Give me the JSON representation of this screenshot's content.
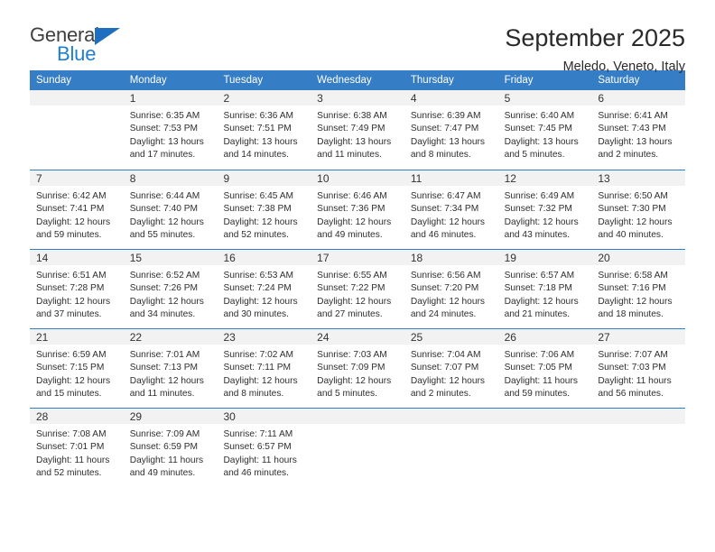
{
  "brand": {
    "name_part1": "General",
    "name_part2": "Blue",
    "triangle_color": "#1f6fc0",
    "blue_color": "#1f7fd0"
  },
  "header": {
    "title": "September 2025",
    "subtitle": "Meledo, Veneto, Italy"
  },
  "theme": {
    "header_blue": "#357dc4",
    "daynum_band": "#f2f2f2",
    "text": "#2e2e2e"
  },
  "calendar": {
    "weekday_headers": [
      "Sunday",
      "Monday",
      "Tuesday",
      "Wednesday",
      "Thursday",
      "Friday",
      "Saturday"
    ],
    "weeks": [
      [
        {
          "day": ""
        },
        {
          "day": "1",
          "sunrise": "Sunrise: 6:35 AM",
          "sunset": "Sunset: 7:53 PM",
          "daylight1": "Daylight: 13 hours",
          "daylight2": "and 17 minutes."
        },
        {
          "day": "2",
          "sunrise": "Sunrise: 6:36 AM",
          "sunset": "Sunset: 7:51 PM",
          "daylight1": "Daylight: 13 hours",
          "daylight2": "and 14 minutes."
        },
        {
          "day": "3",
          "sunrise": "Sunrise: 6:38 AM",
          "sunset": "Sunset: 7:49 PM",
          "daylight1": "Daylight: 13 hours",
          "daylight2": "and 11 minutes."
        },
        {
          "day": "4",
          "sunrise": "Sunrise: 6:39 AM",
          "sunset": "Sunset: 7:47 PM",
          "daylight1": "Daylight: 13 hours",
          "daylight2": "and 8 minutes."
        },
        {
          "day": "5",
          "sunrise": "Sunrise: 6:40 AM",
          "sunset": "Sunset: 7:45 PM",
          "daylight1": "Daylight: 13 hours",
          "daylight2": "and 5 minutes."
        },
        {
          "day": "6",
          "sunrise": "Sunrise: 6:41 AM",
          "sunset": "Sunset: 7:43 PM",
          "daylight1": "Daylight: 13 hours",
          "daylight2": "and 2 minutes."
        }
      ],
      [
        {
          "day": "7",
          "sunrise": "Sunrise: 6:42 AM",
          "sunset": "Sunset: 7:41 PM",
          "daylight1": "Daylight: 12 hours",
          "daylight2": "and 59 minutes."
        },
        {
          "day": "8",
          "sunrise": "Sunrise: 6:44 AM",
          "sunset": "Sunset: 7:40 PM",
          "daylight1": "Daylight: 12 hours",
          "daylight2": "and 55 minutes."
        },
        {
          "day": "9",
          "sunrise": "Sunrise: 6:45 AM",
          "sunset": "Sunset: 7:38 PM",
          "daylight1": "Daylight: 12 hours",
          "daylight2": "and 52 minutes."
        },
        {
          "day": "10",
          "sunrise": "Sunrise: 6:46 AM",
          "sunset": "Sunset: 7:36 PM",
          "daylight1": "Daylight: 12 hours",
          "daylight2": "and 49 minutes."
        },
        {
          "day": "11",
          "sunrise": "Sunrise: 6:47 AM",
          "sunset": "Sunset: 7:34 PM",
          "daylight1": "Daylight: 12 hours",
          "daylight2": "and 46 minutes."
        },
        {
          "day": "12",
          "sunrise": "Sunrise: 6:49 AM",
          "sunset": "Sunset: 7:32 PM",
          "daylight1": "Daylight: 12 hours",
          "daylight2": "and 43 minutes."
        },
        {
          "day": "13",
          "sunrise": "Sunrise: 6:50 AM",
          "sunset": "Sunset: 7:30 PM",
          "daylight1": "Daylight: 12 hours",
          "daylight2": "and 40 minutes."
        }
      ],
      [
        {
          "day": "14",
          "sunrise": "Sunrise: 6:51 AM",
          "sunset": "Sunset: 7:28 PM",
          "daylight1": "Daylight: 12 hours",
          "daylight2": "and 37 minutes."
        },
        {
          "day": "15",
          "sunrise": "Sunrise: 6:52 AM",
          "sunset": "Sunset: 7:26 PM",
          "daylight1": "Daylight: 12 hours",
          "daylight2": "and 34 minutes."
        },
        {
          "day": "16",
          "sunrise": "Sunrise: 6:53 AM",
          "sunset": "Sunset: 7:24 PM",
          "daylight1": "Daylight: 12 hours",
          "daylight2": "and 30 minutes."
        },
        {
          "day": "17",
          "sunrise": "Sunrise: 6:55 AM",
          "sunset": "Sunset: 7:22 PM",
          "daylight1": "Daylight: 12 hours",
          "daylight2": "and 27 minutes."
        },
        {
          "day": "18",
          "sunrise": "Sunrise: 6:56 AM",
          "sunset": "Sunset: 7:20 PM",
          "daylight1": "Daylight: 12 hours",
          "daylight2": "and 24 minutes."
        },
        {
          "day": "19",
          "sunrise": "Sunrise: 6:57 AM",
          "sunset": "Sunset: 7:18 PM",
          "daylight1": "Daylight: 12 hours",
          "daylight2": "and 21 minutes."
        },
        {
          "day": "20",
          "sunrise": "Sunrise: 6:58 AM",
          "sunset": "Sunset: 7:16 PM",
          "daylight1": "Daylight: 12 hours",
          "daylight2": "and 18 minutes."
        }
      ],
      [
        {
          "day": "21",
          "sunrise": "Sunrise: 6:59 AM",
          "sunset": "Sunset: 7:15 PM",
          "daylight1": "Daylight: 12 hours",
          "daylight2": "and 15 minutes."
        },
        {
          "day": "22",
          "sunrise": "Sunrise: 7:01 AM",
          "sunset": "Sunset: 7:13 PM",
          "daylight1": "Daylight: 12 hours",
          "daylight2": "and 11 minutes."
        },
        {
          "day": "23",
          "sunrise": "Sunrise: 7:02 AM",
          "sunset": "Sunset: 7:11 PM",
          "daylight1": "Daylight: 12 hours",
          "daylight2": "and 8 minutes."
        },
        {
          "day": "24",
          "sunrise": "Sunrise: 7:03 AM",
          "sunset": "Sunset: 7:09 PM",
          "daylight1": "Daylight: 12 hours",
          "daylight2": "and 5 minutes."
        },
        {
          "day": "25",
          "sunrise": "Sunrise: 7:04 AM",
          "sunset": "Sunset: 7:07 PM",
          "daylight1": "Daylight: 12 hours",
          "daylight2": "and 2 minutes."
        },
        {
          "day": "26",
          "sunrise": "Sunrise: 7:06 AM",
          "sunset": "Sunset: 7:05 PM",
          "daylight1": "Daylight: 11 hours",
          "daylight2": "and 59 minutes."
        },
        {
          "day": "27",
          "sunrise": "Sunrise: 7:07 AM",
          "sunset": "Sunset: 7:03 PM",
          "daylight1": "Daylight: 11 hours",
          "daylight2": "and 56 minutes."
        }
      ],
      [
        {
          "day": "28",
          "sunrise": "Sunrise: 7:08 AM",
          "sunset": "Sunset: 7:01 PM",
          "daylight1": "Daylight: 11 hours",
          "daylight2": "and 52 minutes."
        },
        {
          "day": "29",
          "sunrise": "Sunrise: 7:09 AM",
          "sunset": "Sunset: 6:59 PM",
          "daylight1": "Daylight: 11 hours",
          "daylight2": "and 49 minutes."
        },
        {
          "day": "30",
          "sunrise": "Sunrise: 7:11 AM",
          "sunset": "Sunset: 6:57 PM",
          "daylight1": "Daylight: 11 hours",
          "daylight2": "and 46 minutes."
        },
        {
          "day": ""
        },
        {
          "day": ""
        },
        {
          "day": ""
        },
        {
          "day": ""
        }
      ]
    ]
  }
}
